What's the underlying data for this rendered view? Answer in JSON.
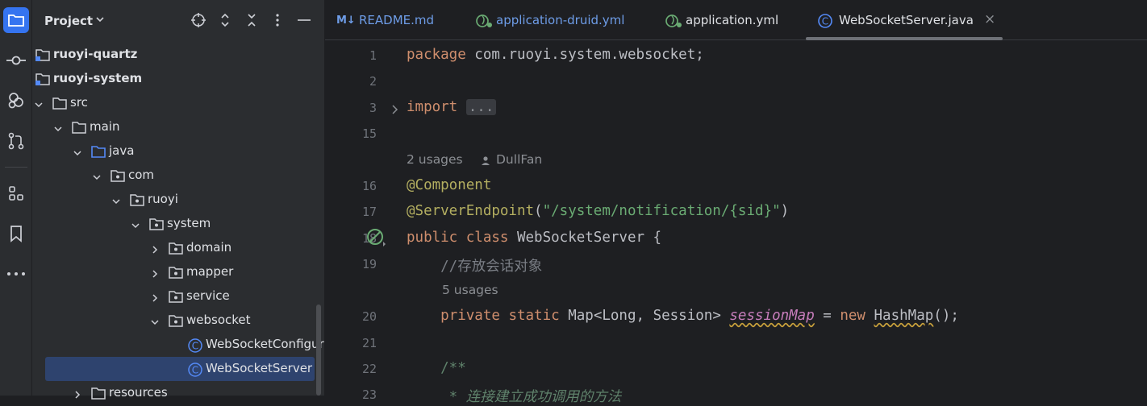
{
  "activity_bar": {
    "items": [
      {
        "icon": "folder-icon",
        "active": true
      },
      {
        "icon": "commit-icon",
        "active": false
      },
      {
        "icon": "services-icon",
        "active": false
      },
      {
        "icon": "pull-requests-icon",
        "active": false
      },
      {
        "icon": "structure-icon",
        "active": false
      },
      {
        "icon": "bookmarks-icon",
        "active": false
      },
      {
        "icon": "more-icon",
        "active": false
      }
    ],
    "accent": "#3574f0"
  },
  "project": {
    "title": "Project",
    "header_icons": [
      "target-icon",
      "expand-icon",
      "collapse-icon",
      "options-icon",
      "hide-icon"
    ],
    "tree": [
      {
        "label": "ruoyi-quartz",
        "depth": 0,
        "icon": "module-icon",
        "arrow": "none",
        "bold": true
      },
      {
        "label": "ruoyi-system",
        "depth": 0,
        "icon": "module-icon",
        "arrow": "none",
        "bold": true
      },
      {
        "label": "src",
        "depth": 1,
        "icon": "folder-icon",
        "arrow": "down"
      },
      {
        "label": "main",
        "depth": 2,
        "icon": "folder-icon",
        "arrow": "down"
      },
      {
        "label": "java",
        "depth": 3,
        "icon": "source-folder-icon",
        "arrow": "down"
      },
      {
        "label": "com",
        "depth": 4,
        "icon": "package-icon",
        "arrow": "down"
      },
      {
        "label": "ruoyi",
        "depth": 5,
        "icon": "package-icon",
        "arrow": "down"
      },
      {
        "label": "system",
        "depth": 6,
        "icon": "package-icon",
        "arrow": "down"
      },
      {
        "label": "domain",
        "depth": 7,
        "icon": "package-icon",
        "arrow": "right"
      },
      {
        "label": "mapper",
        "depth": 7,
        "icon": "package-icon",
        "arrow": "right"
      },
      {
        "label": "service",
        "depth": 7,
        "icon": "package-icon",
        "arrow": "right"
      },
      {
        "label": "websocket",
        "depth": 7,
        "icon": "package-icon",
        "arrow": "down"
      },
      {
        "label": "WebSocketConfigur",
        "depth": 8,
        "icon": "class-icon",
        "arrow": "none"
      },
      {
        "label": "WebSocketServer",
        "depth": 8,
        "icon": "class-icon",
        "arrow": "none",
        "selected": true
      },
      {
        "label": "resources",
        "depth": 3,
        "icon": "folder-icon",
        "arrow": "right"
      }
    ]
  },
  "tabs": [
    {
      "label": "README.md",
      "icon": "markdown-icon",
      "color": "#6e9de8"
    },
    {
      "label": "application-druid.yml",
      "icon": "spring-leaf-icon",
      "color": "#6e9de8"
    },
    {
      "label": "application.yml",
      "icon": "spring-leaf-icon",
      "color": "#dfe1e5"
    },
    {
      "label": "WebSocketServer.java",
      "icon": "class-icon",
      "color": "#dfe1e5",
      "active": true,
      "close": "×"
    }
  ],
  "markdown_badge": "M↓",
  "editor": {
    "line_numbers": [
      "1",
      "2",
      "3",
      "15",
      "16",
      "17",
      "18",
      "19",
      "20",
      "21",
      "22",
      "23"
    ],
    "hint_usages_1": "2 usages",
    "hint_author": "DullFan",
    "hint_usages_2": "5 usages",
    "code": {
      "l1_kw": "package",
      "l1_rest": " com.ruoyi.system.websocket;",
      "l3_kw": "import",
      "l3_fold": "...",
      "l16": "@Component",
      "l17_ann": "@ServerEndpoint",
      "l17_open": "(",
      "l17_str": "\"/system/notification/{sid}\"",
      "l17_close": ")",
      "l18_kw": "public class",
      "l18_rest": " WebSocketServer {",
      "l19_cmt": "    //存放会话对象",
      "l20_indent": "    ",
      "l20_kw": "private static",
      "l20_type": " Map<Long, Session> ",
      "l20_field": "sessionMap",
      "l20_eq": " = ",
      "l20_new": "new",
      "l20_space": " ",
      "l20_ctor": "HashMap",
      "l20_end": "();",
      "l22_doc": "    /**",
      "l23_doc": "     * 连接建立成功调用的方法"
    }
  }
}
